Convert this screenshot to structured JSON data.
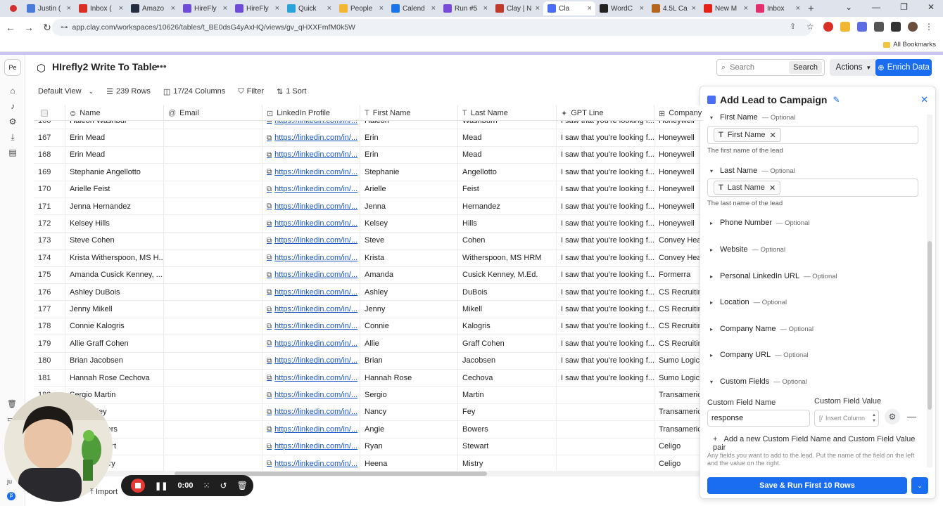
{
  "browser": {
    "tabs": [
      {
        "label": "Justin (",
        "color": "#4a7bd8"
      },
      {
        "label": "Inbox (",
        "color": "#d93025"
      },
      {
        "label": "Amazo",
        "color": "#232f3e"
      },
      {
        "label": "HireFly",
        "color": "#6f4bd8"
      },
      {
        "label": "HireFly",
        "color": "#6f4bd8"
      },
      {
        "label": "Quick",
        "color": "#2aa3d8"
      },
      {
        "label": "People",
        "color": "#f2b632"
      },
      {
        "label": "Calend",
        "color": "#1a73e8"
      },
      {
        "label": "Run #5",
        "color": "#7a4bd8"
      },
      {
        "label": "Clay | N",
        "color": "#c0392b"
      },
      {
        "label": "Cla",
        "color": "#4a6ef5"
      },
      {
        "label": "WordC",
        "color": "#222222"
      },
      {
        "label": "4.5L Ca",
        "color": "#b5651d"
      },
      {
        "label": "New M",
        "color": "#e62117"
      },
      {
        "label": "Inbox",
        "color": "#e1306c"
      }
    ],
    "active_tab_index": 10,
    "new_tab": "+",
    "url": "app.clay.com/workspaces/10626/tables/t_BE0dsG4yAxHQ/views/gv_qHXXFmfM0k5W",
    "bookmarks_label": "All Bookmarks"
  },
  "sidebar": {
    "workspace_initials": "Pe",
    "icons": [
      "home-icon",
      "bell-icon",
      "gear-icon",
      "download-icon",
      "book-icon"
    ]
  },
  "header": {
    "title": "HIrefly2 Write To Table",
    "more": "•••",
    "search_placeholder": "Search",
    "search_button": "Search",
    "actions_label": "Actions",
    "enrich_label": "Enrich Data"
  },
  "toolbar": {
    "view": "Default View",
    "rows": "239 Rows",
    "columns": "17/24 Columns",
    "filter": "Filter",
    "sort": "1 Sort"
  },
  "table": {
    "columns": [
      "",
      "Name",
      "Email",
      "LinkedIn Profile",
      "First Name",
      "Last Name",
      "GPT Line",
      "Company"
    ],
    "rows": [
      [
        "166",
        "Haleon Washbur",
        "",
        "https://linkedin.com/in/...",
        "Haleon",
        "Washburn",
        "I saw that you're looking f...",
        "Honeywell"
      ],
      [
        "167",
        "Erin Mead",
        "",
        "https://linkedin.com/in/...",
        "Erin",
        "Mead",
        "I saw that you're looking f...",
        "Honeywell"
      ],
      [
        "168",
        "Erin Mead",
        "",
        "https://linkedin.com/in/...",
        "Erin",
        "Mead",
        "I saw that you're looking f...",
        "Honeywell"
      ],
      [
        "169",
        "Stephanie Angellotto",
        "",
        "https://linkedin.com/in/...",
        "Stephanie",
        "Angellotto",
        "I saw that you're looking f...",
        "Honeywell"
      ],
      [
        "170",
        "Arielle Feist",
        "",
        "https://linkedin.com/in/...",
        "Arielle",
        "Feist",
        "I saw that you're looking f...",
        "Honeywell"
      ],
      [
        "171",
        "Jenna Hernandez",
        "",
        "https://linkedin.com/in/...",
        "Jenna",
        "Hernandez",
        "I saw that you're looking f...",
        "Honeywell"
      ],
      [
        "172",
        "Kelsey Hills",
        "",
        "https://linkedin.com/in/...",
        "Kelsey",
        "Hills",
        "I saw that you're looking f...",
        "Honeywell"
      ],
      [
        "173",
        "Steve Cohen",
        "",
        "https://linkedin.com/in/...",
        "Steve",
        "Cohen",
        "I saw that you're looking f...",
        "Convey Heal"
      ],
      [
        "174",
        "Krista Witherspoon, MS H...",
        "",
        "https://linkedin.com/in/...",
        "Krista",
        "Witherspoon, MS HRM",
        "I saw that you're looking f...",
        "Convey Heal"
      ],
      [
        "175",
        "Amanda Cusick Kenney, ...",
        "",
        "https://linkedin.com/in/...",
        "Amanda",
        "Cusick Kenney, M.Ed.",
        "I saw that you're looking f...",
        "Formerra"
      ],
      [
        "176",
        "Ashley DuBois",
        "",
        "https://linkedin.com/in/...",
        "Ashley",
        "DuBois",
        "I saw that you're looking f...",
        "CS Recruitin"
      ],
      [
        "177",
        "Jenny Mikell",
        "",
        "https://linkedin.com/in/...",
        "Jenny",
        "Mikell",
        "I saw that you're looking f...",
        "CS Recruitin"
      ],
      [
        "178",
        "Connie Kalogris",
        "",
        "https://linkedin.com/in/...",
        "Connie",
        "Kalogris",
        "I saw that you're looking f...",
        "CS Recruitin"
      ],
      [
        "179",
        "Allie Graff Cohen",
        "",
        "https://linkedin.com/in/...",
        "Allie",
        "Graff Cohen",
        "I saw that you're looking f...",
        "CS Recruitin"
      ],
      [
        "180",
        "Brian Jacobsen",
        "",
        "https://linkedin.com/in/...",
        "Brian",
        "Jacobsen",
        "I saw that you're looking f...",
        "Sumo Logic"
      ],
      [
        "181",
        "Hannah Rose Cechova",
        "",
        "https://linkedin.com/in/...",
        "Hannah Rose",
        "Cechova",
        "I saw that you're looking f...",
        "Sumo Logic"
      ],
      [
        "182",
        "Sergio Martin",
        "",
        "https://linkedin.com/in/...",
        "Sergio",
        "Martin",
        "",
        "Transameric"
      ],
      [
        "183",
        "Nancy Fey",
        "",
        "https://linkedin.com/in/...",
        "Nancy",
        "Fey",
        "",
        "Transameric"
      ],
      [
        "184",
        "Angie Bowers",
        "",
        "https://linkedin.com/in/...",
        "Angie",
        "Bowers",
        "",
        "Transameric"
      ],
      [
        "185",
        "Ryan Stewart",
        "",
        "https://linkedin.com/in/...",
        "Ryan",
        "Stewart",
        "",
        "Celigo"
      ],
      [
        "186",
        "Heena Mistry",
        "",
        "https://linkedin.com/in/...",
        "Heena",
        "Mistry",
        "",
        "Celigo"
      ]
    ]
  },
  "panel": {
    "title": "Add Lead to Campaign",
    "first_name": {
      "label": "First Name",
      "optional": "— Optional",
      "chip": "First Name",
      "help": "The first name of the lead"
    },
    "last_name": {
      "label": "Last Name",
      "optional": "— Optional",
      "chip": "Last Name",
      "help": "The last name of the lead"
    },
    "collapsed": [
      {
        "label": "Phone Number",
        "optional": "— Optional"
      },
      {
        "label": "Website",
        "optional": "— Optional"
      },
      {
        "label": "Personal LinkedIn URL",
        "optional": "— Optional"
      },
      {
        "label": "Location",
        "optional": "— Optional"
      },
      {
        "label": "Company Name",
        "optional": "— Optional"
      },
      {
        "label": "Company URL",
        "optional": "— Optional"
      }
    ],
    "custom_fields": {
      "label": "Custom Fields",
      "optional": "— Optional",
      "name_label": "Custom Field Name",
      "value_label": "Custom Field Value",
      "name_value": "response",
      "value_placeholder": "Insert Column",
      "add_pair": "Add a new Custom Field Name and Custom Field Value pair",
      "help": "Any fields you want to add to the lead. Put the name of the field on the left and the value on the right."
    },
    "save_label": "Save & Run First 10 Rows"
  },
  "recorder": {
    "time": "0:00",
    "import_label": "Import"
  }
}
